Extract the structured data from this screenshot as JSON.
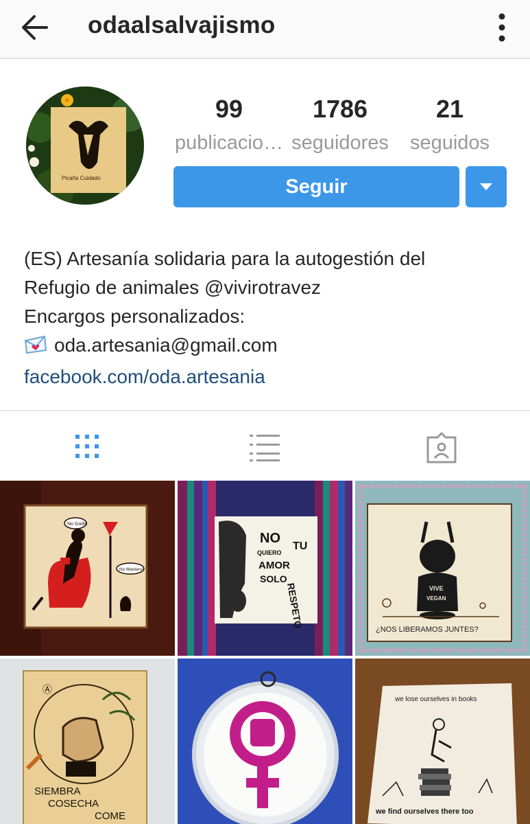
{
  "header": {
    "username": "odaalsalvajismo",
    "back_icon": "arrow-left-icon",
    "more_icon": "more-vertical-icon"
  },
  "profile": {
    "avatar_text": "Picaña Cuidado",
    "stats": [
      {
        "value": "99",
        "label": "publicacio…"
      },
      {
        "value": "1786",
        "label": "seguidores"
      },
      {
        "value": "21",
        "label": "seguidos"
      }
    ],
    "follow_label": "Seguir",
    "dropdown_icon": "caret-down-icon"
  },
  "bio": {
    "line1": "(ES) Artesanía solidaria para la autogestión del",
    "line2": "Refugio de animales @vivirotravez",
    "line3": "Encargos personalizados:",
    "email": "oda.artesania@gmail.com",
    "link": "facebook.com/oda.artesania"
  },
  "tabs": [
    {
      "name": "grid-view",
      "icon": "grid-icon",
      "active": true
    },
    {
      "name": "list-view",
      "icon": "list-icon",
      "active": false
    },
    {
      "name": "tagged-view",
      "icon": "tagged-person-icon",
      "active": false
    }
  ],
  "posts": {
    "p1": {
      "bubble1": "No Gods!",
      "bubble2": "No Masters!"
    },
    "p2": {
      "words": [
        "NO",
        "QUIERO",
        "TU",
        "AMOR",
        "SOLO",
        "RESPETO"
      ]
    },
    "p3": {
      "shirt1": "VIVE",
      "shirt2": "VEGAN",
      "caption": "¿NOS LIBERAMOS JUNTES?"
    },
    "p4": {
      "line1": "SIEMBRA",
      "line2": "COSECHA",
      "line3": "COME"
    },
    "p5": {},
    "p6": {
      "top": "we lose ourselves in books",
      "bottom": "we find ourselves there too"
    }
  },
  "colors": {
    "accent": "#3d97e8",
    "tab_active": "#3d97e8",
    "link": "#1e4e7b",
    "muted": "#999999"
  }
}
